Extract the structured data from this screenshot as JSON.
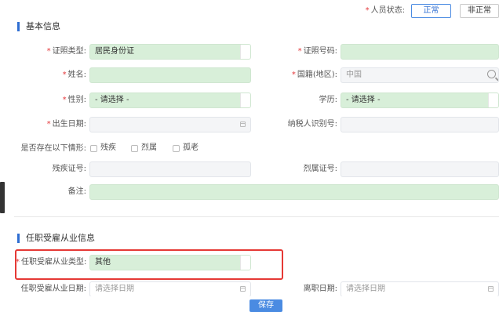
{
  "personnel_status": {
    "label": "人员状态:",
    "options": [
      "正常",
      "非正常"
    ],
    "selected": "正常"
  },
  "basic_info": {
    "title": "基本信息",
    "id_type": {
      "label": "证照类型:",
      "value": "居民身份证"
    },
    "id_number": {
      "label": "证照号码:",
      "value": ""
    },
    "name": {
      "label": "姓名:",
      "value": ""
    },
    "nationality": {
      "label": "国籍(地区):",
      "value": "中国"
    },
    "gender": {
      "label": "性别:",
      "value": "- 请选择 -"
    },
    "education": {
      "label": "学历:",
      "value": "- 请选择 -"
    },
    "birth_date": {
      "label": "出生日期:",
      "value": ""
    },
    "taxpayer_id": {
      "label": "纳税人识别号:",
      "value": ""
    },
    "special_status": {
      "label": "是否存在以下情形:",
      "options": [
        "残疾",
        "烈属",
        "孤老"
      ]
    },
    "disability_cert": {
      "label": "残疾证号:",
      "value": ""
    },
    "martyr_cert": {
      "label": "烈属证号:",
      "value": ""
    },
    "remarks": {
      "label": "备注:",
      "value": ""
    }
  },
  "employment_info": {
    "title": "任职受雇从业信息",
    "employment_type": {
      "label": "任职受雇从业类型:",
      "value": "其他"
    },
    "employment_date": {
      "label": "任职受雇从业日期:",
      "placeholder": "请选择日期"
    },
    "departure_date": {
      "label": "离职日期:",
      "placeholder": "请选择日期"
    }
  },
  "footer": {
    "save_label": "保存"
  },
  "colors": {
    "accent": "#2f6ed2",
    "field_green": "#d8efd9",
    "highlight_red": "#e53935",
    "required_red": "#e4393c"
  }
}
